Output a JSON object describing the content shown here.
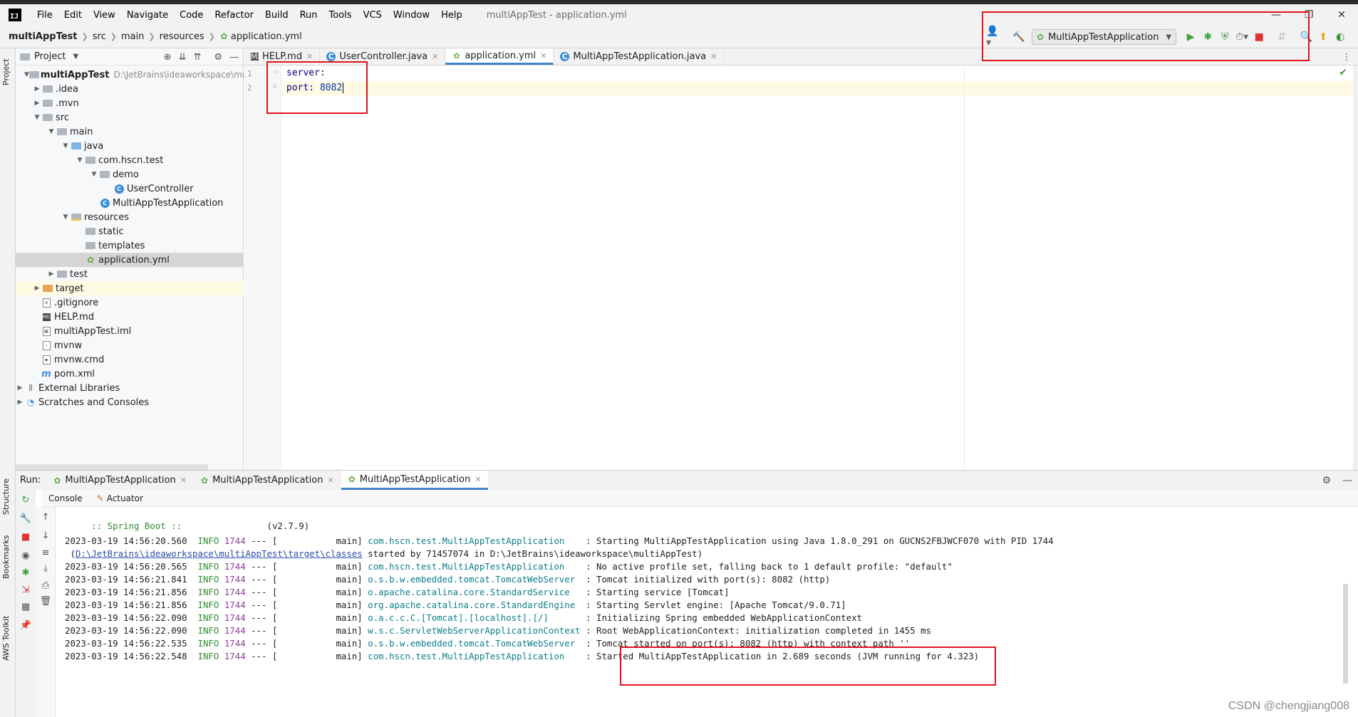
{
  "menu": {
    "logo": "IJ",
    "items": [
      "File",
      "Edit",
      "View",
      "Navigate",
      "Code",
      "Refactor",
      "Build",
      "Run",
      "Tools",
      "VCS",
      "Window",
      "Help"
    ],
    "window_title": "multiAppTest - application.yml"
  },
  "breadcrumb": {
    "project": "multiAppTest",
    "src": "src",
    "main": "main",
    "resources": "resources",
    "file": "application.yml"
  },
  "toolbar": {
    "run_config": "MultiAppTestApplication"
  },
  "left_strip": {
    "project": "Project",
    "structure": "Structure",
    "bookmarks": "Bookmarks",
    "aws": "AWS Toolkit"
  },
  "project_panel": {
    "title": "Project",
    "tree": [
      {
        "label": "multiAppTest",
        "path": "D:\\JetBrains\\ideaworkspace\\mult"
      },
      {
        "label": ".idea"
      },
      {
        "label": ".mvn"
      },
      {
        "label": "src"
      },
      {
        "label": "main"
      },
      {
        "label": "java"
      },
      {
        "label": "com.hscn.test"
      },
      {
        "label": "demo"
      },
      {
        "label": "UserController"
      },
      {
        "label": "MultiAppTestApplication"
      },
      {
        "label": "resources"
      },
      {
        "label": "static"
      },
      {
        "label": "templates"
      },
      {
        "label": "application.yml"
      },
      {
        "label": "test"
      },
      {
        "label": "target"
      },
      {
        "label": ".gitignore"
      },
      {
        "label": "HELP.md"
      },
      {
        "label": "multiAppTest.iml"
      },
      {
        "label": "mvnw"
      },
      {
        "label": "mvnw.cmd"
      },
      {
        "label": "pom.xml"
      },
      {
        "label": "External Libraries"
      },
      {
        "label": "Scratches and Consoles"
      }
    ]
  },
  "editor_tabs": [
    "HELP.md",
    "UserController.java",
    "application.yml",
    "MultiAppTestApplication.java"
  ],
  "editor": {
    "line_numbers": [
      "1",
      "2"
    ],
    "line1_key": "server:",
    "line2_key": "port:",
    "line2_value": "8082"
  },
  "run_panel": {
    "label": "Run:",
    "tabs": [
      "MultiAppTestApplication",
      "MultiAppTestApplication",
      "MultiAppTestApplication"
    ],
    "subtabs": [
      "Console",
      "Actuator"
    ]
  },
  "console": {
    "banner_prefix": " :: Spring Boot :: ",
    "banner_version": "               (v2.7.9)",
    "continuation_prefix": " (",
    "continuation_link": "D:\\JetBrains\\ideaworkspace\\multiAppTest\\target\\classes",
    "continuation_rest": " started by 71457074 in D:\\JetBrains\\ideaworkspace\\multiAppTest)",
    "lines": [
      {
        "ts": "2023-03-19 14:56:20.560",
        "level": "INFO",
        "pid": "1744",
        "thread": " --- [           main] ",
        "logger": "com.hscn.test.MultiAppTestApplication    ",
        "msg": ": Starting MultiAppTestApplication using Java 1.8.0_291 on GUCNS2FBJWCF070 with PID 1744"
      },
      {
        "ts": "2023-03-19 14:56:20.565",
        "level": "INFO",
        "pid": "1744",
        "thread": " --- [           main] ",
        "logger": "com.hscn.test.MultiAppTestApplication    ",
        "msg": ": No active profile set, falling back to 1 default profile: \"default\""
      },
      {
        "ts": "2023-03-19 14:56:21.841",
        "level": "INFO",
        "pid": "1744",
        "thread": " --- [           main] ",
        "logger": "o.s.b.w.embedded.tomcat.TomcatWebServer  ",
        "msg": ": Tomcat initialized with port(s): 8082 (http)"
      },
      {
        "ts": "2023-03-19 14:56:21.856",
        "level": "INFO",
        "pid": "1744",
        "thread": " --- [           main] ",
        "logger": "o.apache.catalina.core.StandardService   ",
        "msg": ": Starting service [Tomcat]"
      },
      {
        "ts": "2023-03-19 14:56:21.856",
        "level": "INFO",
        "pid": "1744",
        "thread": " --- [           main] ",
        "logger": "org.apache.catalina.core.StandardEngine  ",
        "msg": ": Starting Servlet engine: [Apache Tomcat/9.0.71]"
      },
      {
        "ts": "2023-03-19 14:56:22.090",
        "level": "INFO",
        "pid": "1744",
        "thread": " --- [           main] ",
        "logger": "o.a.c.c.C.[Tomcat].[localhost].[/]       ",
        "msg": ": Initializing Spring embedded WebApplicationContext"
      },
      {
        "ts": "2023-03-19 14:56:22.090",
        "level": "INFO",
        "pid": "1744",
        "thread": " --- [           main] ",
        "logger": "w.s.c.ServletWebServerApplicationContext ",
        "msg": ": Root WebApplicationContext: initialization completed in 1455 ms"
      },
      {
        "ts": "2023-03-19 14:56:22.535",
        "level": "INFO",
        "pid": "1744",
        "thread": " --- [           main] ",
        "logger": "o.s.b.w.embedded.tomcat.TomcatWebServer  ",
        "msg": ": Tomcat started on port(s): 8082 (http) with context path ''"
      },
      {
        "ts": "2023-03-19 14:56:22.548",
        "level": "INFO",
        "pid": "1744",
        "thread": " --- [           main] ",
        "logger": "com.hscn.test.MultiAppTestApplication    ",
        "msg": ": Started MultiAppTestApplication in 2.689 seconds (JVM running for 4.323)"
      }
    ]
  },
  "watermark": "CSDN @chengjiang008",
  "colors": {
    "highlight_box": "#e0141c",
    "run_green": "#6aa84f",
    "accent_blue": "#4083c9"
  }
}
